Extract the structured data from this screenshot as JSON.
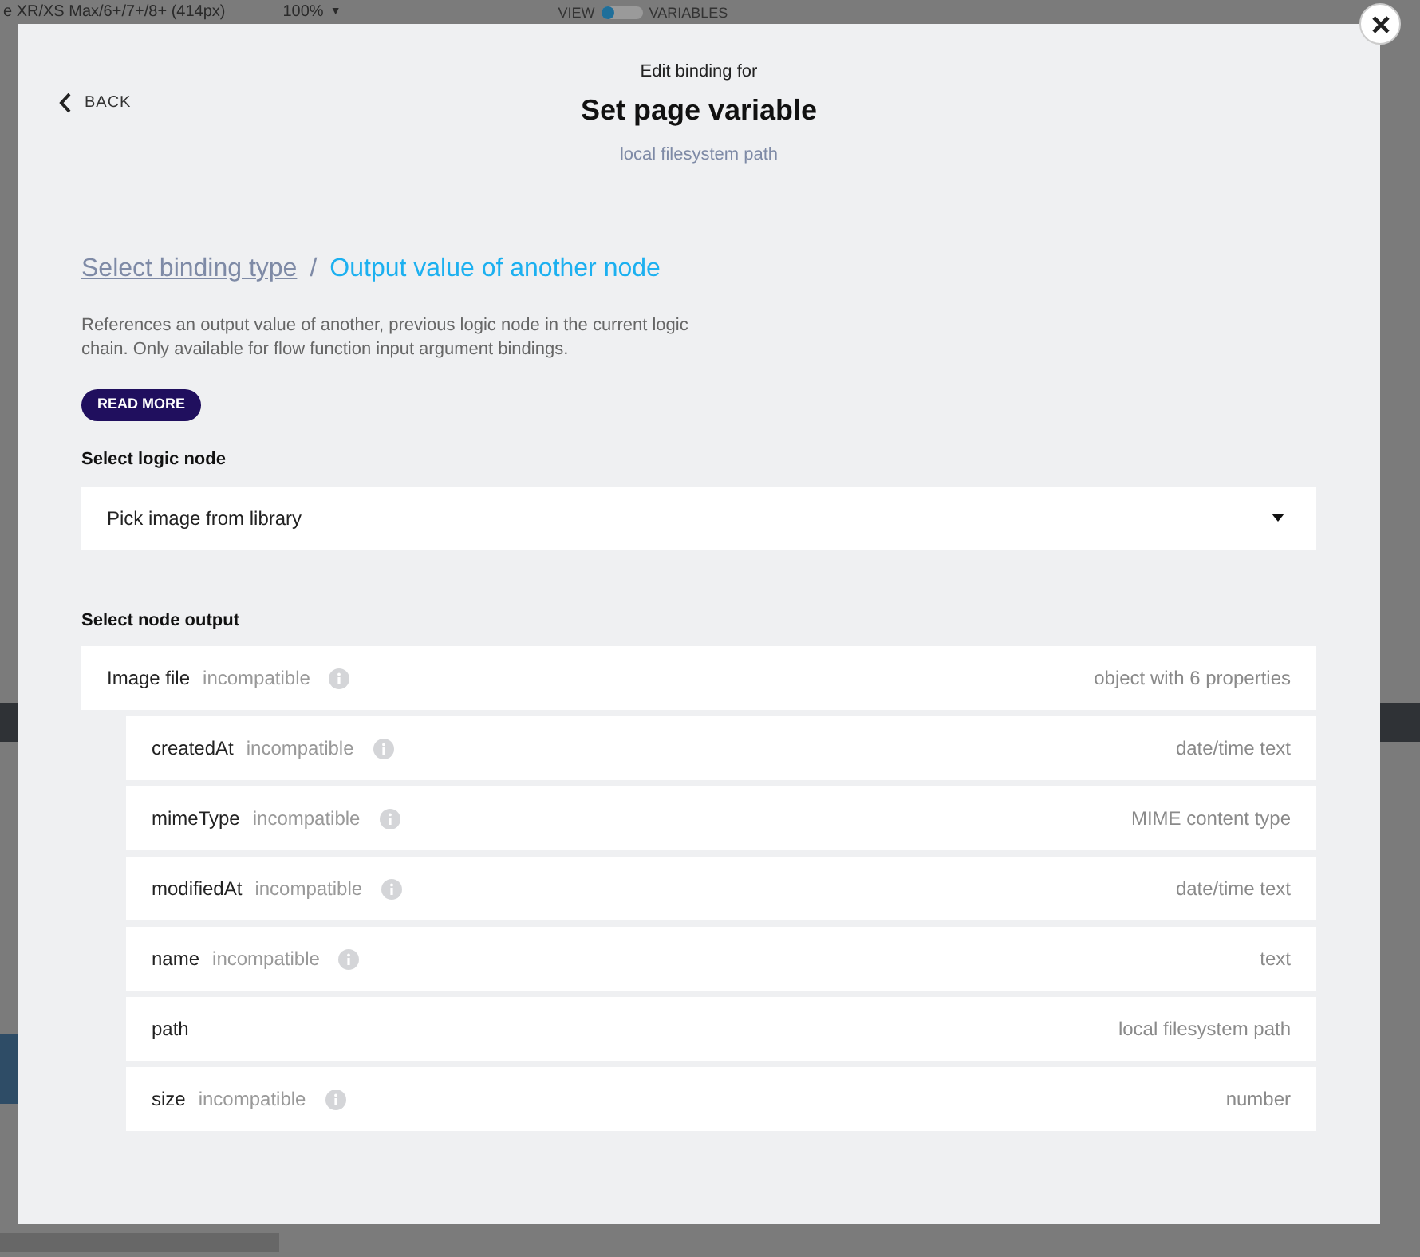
{
  "background": {
    "device": "e XR/XS Max/6+/7+/8+ (414px)",
    "zoom": "100%",
    "zoom_caret": "▼",
    "toggle_left": "VIEW",
    "toggle": {
      "on": false
    },
    "toggle_right": "VARIABLES"
  },
  "dialog": {
    "back": "BACK",
    "eyebrow": "Edit binding for",
    "title": "Set page variable",
    "value_type": "local filesystem path",
    "breadcrumb": {
      "link": "Select binding type",
      "separator": "/",
      "current": "Output value of another node"
    },
    "description": "References an output value of another, previous logic node in the current logic chain. Only available for flow function input argument bindings.",
    "read_more": "READ MORE",
    "logic_node": {
      "label": "Select logic node",
      "value": "Pick image from library"
    },
    "node_output": {
      "label": "Select node output",
      "items": [
        {
          "name": "Image file",
          "compatible": false,
          "note": "incompatible",
          "type": "object with 6 properties",
          "children": [
            {
              "name": "createdAt",
              "compatible": false,
              "note": "incompatible",
              "type": "date/time text"
            },
            {
              "name": "mimeType",
              "compatible": false,
              "note": "incompatible",
              "type": "MIME content type"
            },
            {
              "name": "modifiedAt",
              "compatible": false,
              "note": "incompatible",
              "type": "date/time text"
            },
            {
              "name": "name",
              "compatible": false,
              "note": "incompatible",
              "type": "text"
            },
            {
              "name": "path",
              "compatible": true,
              "type": "local filesystem path"
            },
            {
              "name": "size",
              "compatible": false,
              "note": "incompatible",
              "type": "number"
            }
          ]
        }
      ]
    }
  }
}
